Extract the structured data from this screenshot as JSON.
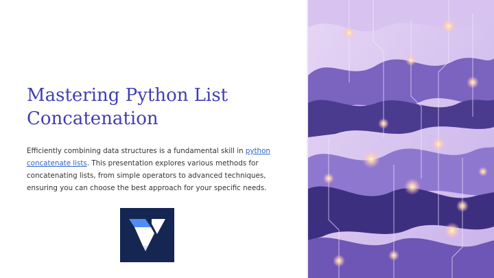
{
  "slide": {
    "title_line1": "Mastering Python List",
    "title_line2": "Concatenation",
    "desc_before": "Efficiently combining data structures is a fundamental skill in ",
    "desc_link": "python concatenate lists",
    "desc_after": ". This presentation explores various methods for concatenating lists, from simple operators to advanced techniques, ensuring you can choose the best approach for your specific needs."
  },
  "logo": {
    "icon": "brand-v-logo",
    "background": "#152652",
    "accent": "#4d8ef0"
  },
  "colors": {
    "title": "#3f3fb0",
    "link": "#2e63c9",
    "text": "#333333",
    "art_deep": "#4a3b8f",
    "art_mid": "#8a73c7",
    "art_light": "#d9c8ef",
    "glow": "#ffd9a8"
  }
}
